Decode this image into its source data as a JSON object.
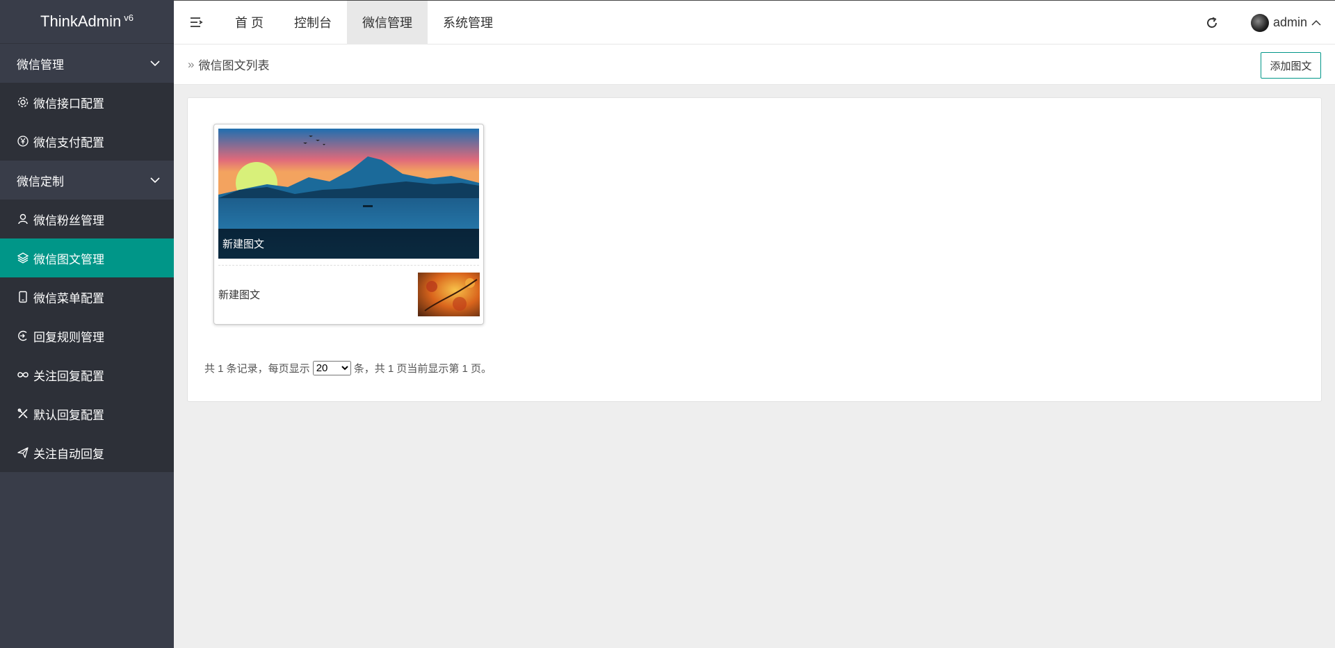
{
  "app": {
    "title": "ThinkAdmin",
    "version": "v6"
  },
  "sidebar": {
    "groups": [
      {
        "label": "微信管理",
        "items": [
          {
            "label": "微信接口配置",
            "icon": "gear-icon"
          },
          {
            "label": "微信支付配置",
            "icon": "yen-icon"
          }
        ]
      },
      {
        "label": "微信定制",
        "items": [
          {
            "label": "微信粉丝管理",
            "icon": "user-icon"
          },
          {
            "label": "微信图文管理",
            "icon": "layers-icon",
            "active": true
          },
          {
            "label": "微信菜单配置",
            "icon": "phone-icon"
          },
          {
            "label": "回复规则管理",
            "icon": "reply-icon"
          },
          {
            "label": "关注回复配置",
            "icon": "infinity-icon"
          },
          {
            "label": "默认回复配置",
            "icon": "tools-icon"
          },
          {
            "label": "关注自动回复",
            "icon": "send-icon"
          }
        ]
      }
    ]
  },
  "topnav": {
    "tabs": [
      "首 页",
      "控制台",
      "微信管理",
      "系统管理"
    ],
    "active_index": 2,
    "user": "admin"
  },
  "breadcrumb": {
    "arrow": "»",
    "title": "微信图文列表"
  },
  "actions": {
    "add_label": "添加图文"
  },
  "news": {
    "main_title": "新建图文",
    "sub_title": "新建图文"
  },
  "pager": {
    "prefix": "共 1 条记录，每页显示",
    "page_size": "20",
    "suffix": "条，共 1 页当前显示第 1 页。"
  },
  "colors": {
    "accent": "#009688",
    "sidebar": "#393d49",
    "sidebar_item": "#2d3038"
  }
}
